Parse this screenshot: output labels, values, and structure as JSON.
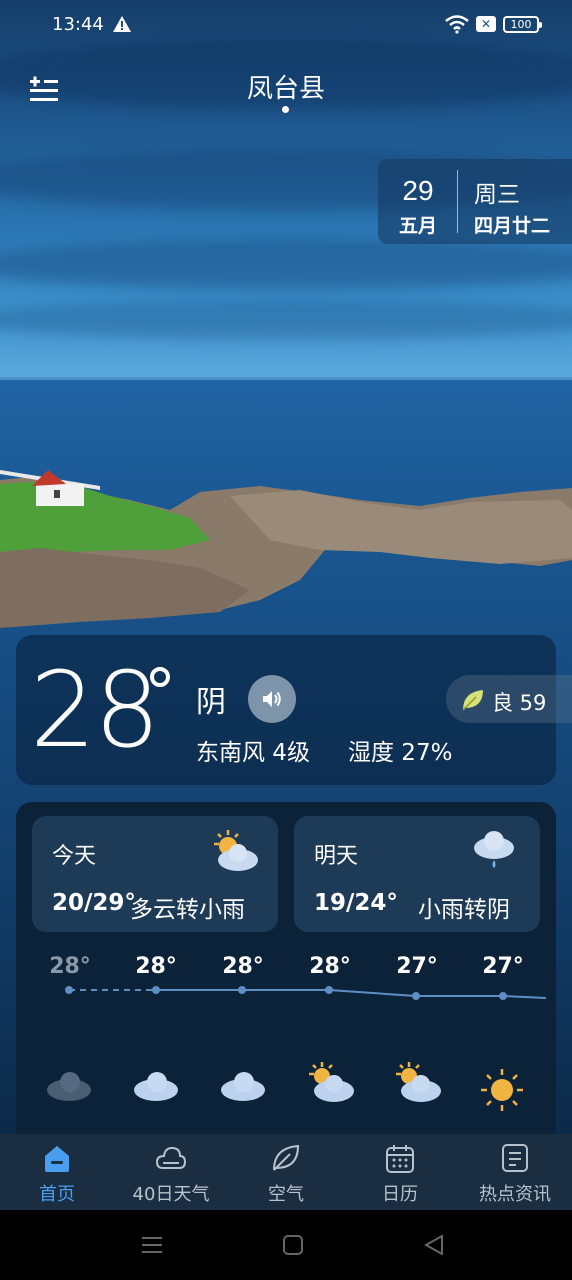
{
  "status_bar": {
    "time": "13:44",
    "battery": "100"
  },
  "header": {
    "city": "凤台县"
  },
  "date_card": {
    "day": "29",
    "month": "五月",
    "weekday": "周三",
    "lunar": "四月廿二"
  },
  "current": {
    "temperature": "28",
    "condition": "阴",
    "aqi_label": "良 59",
    "wind": "东南风 4级",
    "humidity": "湿度 27%"
  },
  "forecast": {
    "today": {
      "label": "今天",
      "range": "20/29°",
      "desc": "多云转小雨",
      "icon": "partly-cloudy-icon"
    },
    "tomorrow": {
      "label": "明天",
      "range": "19/24°",
      "desc": "小雨转阴",
      "icon": "light-rain-icon"
    }
  },
  "hourly": [
    {
      "temp": "28°",
      "icon": "dark-cloud-icon",
      "past": true
    },
    {
      "temp": "28°",
      "icon": "cloud-icon",
      "past": false
    },
    {
      "temp": "28°",
      "icon": "cloud-icon",
      "past": false
    },
    {
      "temp": "28°",
      "icon": "partly-cloudy-icon",
      "past": false
    },
    {
      "temp": "27°",
      "icon": "partly-cloudy-icon",
      "past": false
    },
    {
      "temp": "27°",
      "icon": "sun-icon",
      "past": false
    }
  ],
  "nav": [
    {
      "label": "首页",
      "icon": "home-icon",
      "active": true
    },
    {
      "label": "40日天气",
      "icon": "cloud-outline-icon",
      "active": false
    },
    {
      "label": "空气",
      "icon": "leaf-icon",
      "active": false
    },
    {
      "label": "日历",
      "icon": "calendar-icon",
      "active": false
    },
    {
      "label": "热点资讯",
      "icon": "news-icon",
      "active": false
    }
  ],
  "colors": {
    "accent": "#4a9ef0",
    "past_temp": "#8a98a8",
    "line": "#5d8ec4"
  }
}
